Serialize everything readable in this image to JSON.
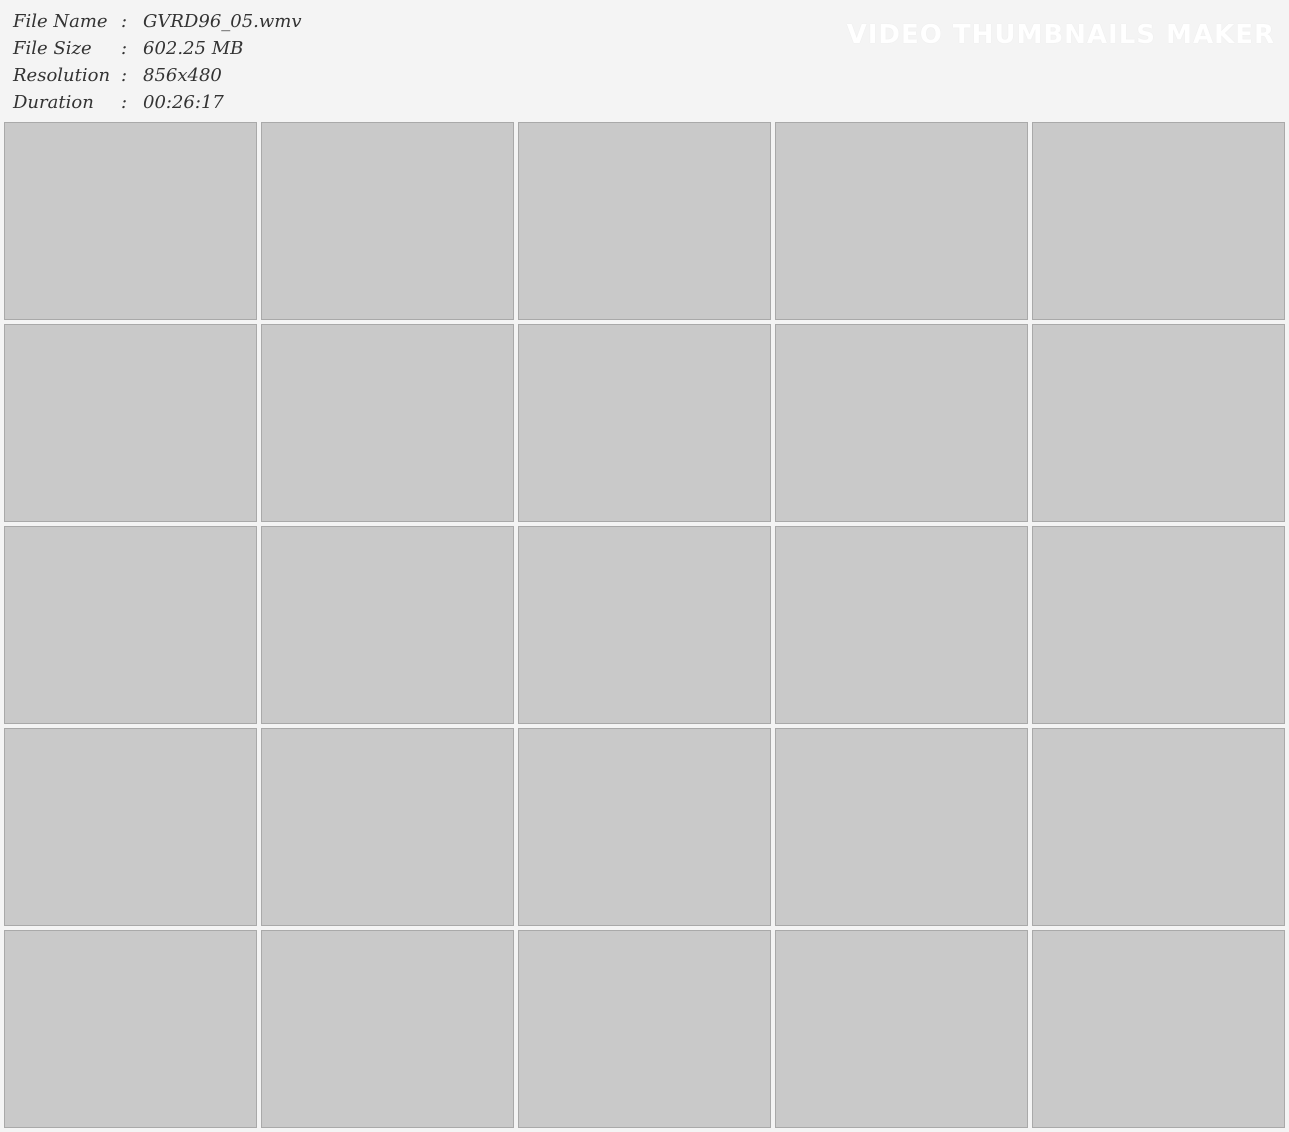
{
  "file_info": {
    "file_name_label": "File Name",
    "file_name_value": "GVRD96_05.wmv",
    "file_size_label": "File Size",
    "file_size_value": "602.25 MB",
    "resolution_label": "Resolution",
    "resolution_value": "856x480",
    "duration_label": "Duration",
    "duration_value": "00:26:17",
    "separator": ":"
  },
  "watermark": "VIDEO THUMBNAILS MAKER",
  "thumbnail_grid": {
    "columns": 5,
    "rows": 5
  }
}
